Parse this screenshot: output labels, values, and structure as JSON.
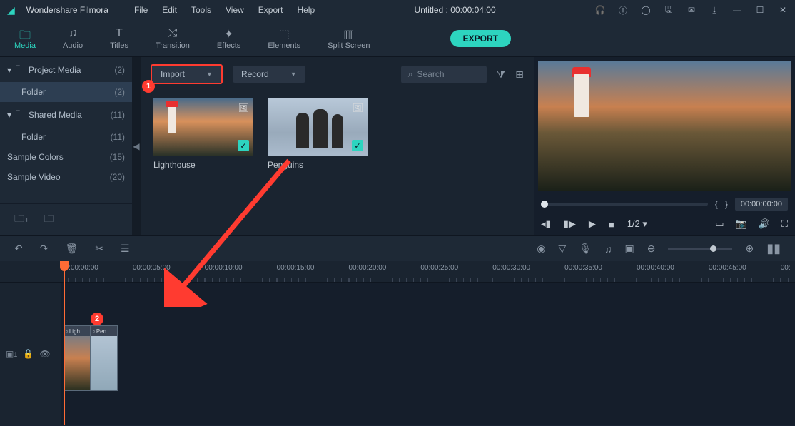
{
  "app": {
    "name": "Wondershare Filmora",
    "doc_title": "Untitled : 00:00:04:00"
  },
  "menus": [
    "File",
    "Edit",
    "Tools",
    "View",
    "Export",
    "Help"
  ],
  "tool_tabs": [
    {
      "label": "Media",
      "active": true
    },
    {
      "label": "Audio"
    },
    {
      "label": "Titles"
    },
    {
      "label": "Transition"
    },
    {
      "label": "Effects"
    },
    {
      "label": "Elements"
    },
    {
      "label": "Split Screen"
    }
  ],
  "export_label": "EXPORT",
  "sidebar": [
    {
      "label": "Project Media",
      "count": "(2)",
      "chev": true,
      "folder": true
    },
    {
      "label": "Folder",
      "count": "(2)",
      "sel": true
    },
    {
      "label": "Shared Media",
      "count": "(11)",
      "chev": true,
      "folder": true
    },
    {
      "label": "Folder",
      "count": "(11)"
    },
    {
      "label": "Sample Colors",
      "count": "(15)"
    },
    {
      "label": "Sample Video",
      "count": "(20)"
    }
  ],
  "import_label": "Import",
  "record_label": "Record",
  "search_placeholder": "Search",
  "media": [
    {
      "name": "Lighthouse",
      "cls": "lighthouse-bg"
    },
    {
      "name": "Penguins",
      "cls": "penguin-bg"
    }
  ],
  "preview": {
    "time": "00:00:00:00",
    "speed": "1/2",
    "brackets_l": "{",
    "brackets_r": "}"
  },
  "ruler": [
    "00:00:00:00",
    "00:00:05:00",
    "00:00:10:00",
    "00:00:15:00",
    "00:00:20:00",
    "00:00:25:00",
    "00:00:30:00",
    "00:00:35:00",
    "00:00:40:00",
    "00:00:45:00",
    "00:"
  ],
  "clips": [
    {
      "label": "Ligh"
    },
    {
      "label": "Pen"
    }
  ],
  "track_label": "1",
  "callouts": {
    "one": "1",
    "two": "2"
  }
}
